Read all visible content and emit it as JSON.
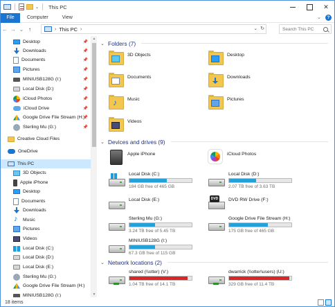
{
  "window": {
    "title": "This PC",
    "minimize_label": "",
    "maximize_label": "",
    "close_label": "✕"
  },
  "ribbon": {
    "tabs": [
      "File",
      "Computer",
      "View"
    ],
    "expand_glyph": "⌄",
    "help_glyph": "?"
  },
  "address": {
    "back_glyph": "←",
    "forward_glyph": "→",
    "recent_glyph": "⌄",
    "up_glyph": "↑",
    "path": "This PC",
    "separator": "›",
    "dropdown_glyph": "⌄",
    "refresh_glyph": "↻",
    "search_placeholder": "Search This PC"
  },
  "nav": {
    "pin_glyph": "📌",
    "items": [
      {
        "label": "Desktop",
        "icon": "desktop-icon",
        "pinned": true
      },
      {
        "label": "Downloads",
        "icon": "downloads-icon",
        "pinned": true
      },
      {
        "label": "Documents",
        "icon": "documents-icon",
        "pinned": true
      },
      {
        "label": "Pictures",
        "icon": "pictures-icon",
        "pinned": true
      },
      {
        "label": "MINIUSB128G (I:)",
        "icon": "usb-drive-icon",
        "pinned": true
      },
      {
        "label": "Local Disk (D:)",
        "icon": "drive-icon",
        "pinned": true
      },
      {
        "label": "iCloud Photos",
        "icon": "icloud-photos-icon",
        "pinned": true
      },
      {
        "label": "iCloud Drive",
        "icon": "icloud-drive-icon",
        "pinned": true
      },
      {
        "label": "Google Drive File Stream (H:)",
        "icon": "google-drive-icon",
        "pinned": true
      },
      {
        "label": "Sterling Mu (G:)",
        "icon": "user-drive-icon",
        "pinned": true
      },
      {
        "label": "Creative Cloud Files",
        "icon": "creative-cloud-icon",
        "pinned": false
      },
      {
        "label": "OneDrive",
        "icon": "onedrive-icon",
        "pinned": false
      },
      {
        "label": "This PC",
        "icon": "this-pc-icon",
        "pinned": false
      },
      {
        "label": "3D Objects",
        "icon": "3d-objects-icon",
        "pinned": false
      },
      {
        "label": "Apple iPhone",
        "icon": "iphone-icon",
        "pinned": false
      },
      {
        "label": "Desktop",
        "icon": "desktop-icon",
        "pinned": false
      },
      {
        "label": "Documents",
        "icon": "documents-icon",
        "pinned": false
      },
      {
        "label": "Downloads",
        "icon": "downloads-icon",
        "pinned": false
      },
      {
        "label": "Music",
        "icon": "music-icon",
        "pinned": false
      },
      {
        "label": "Pictures",
        "icon": "pictures-icon",
        "pinned": false
      },
      {
        "label": "Videos",
        "icon": "videos-icon",
        "pinned": false
      },
      {
        "label": "Local Disk (C:)",
        "icon": "windows-drive-icon",
        "pinned": false
      },
      {
        "label": "Local Disk (D:)",
        "icon": "drive-icon",
        "pinned": false
      },
      {
        "label": "Local Disk (E:)",
        "icon": "drive-icon",
        "pinned": false
      },
      {
        "label": "Sterling Mu (G:)",
        "icon": "user-drive-icon",
        "pinned": false
      },
      {
        "label": "Google Drive File Stream (H:)",
        "icon": "google-drive-icon",
        "pinned": false
      },
      {
        "label": "MINIUSB128G (I:)",
        "icon": "usb-drive-icon",
        "pinned": false
      }
    ]
  },
  "groups": {
    "folders": {
      "header": "Folders (7)",
      "items": [
        {
          "label": "3D Objects",
          "badge": "objects"
        },
        {
          "label": "Desktop",
          "badge": "desktop"
        },
        {
          "label": "Documents",
          "badge": "docs"
        },
        {
          "label": "Downloads",
          "badge": "downloads"
        },
        {
          "label": "Music",
          "badge": "music"
        },
        {
          "label": "Pictures",
          "badge": "pictures"
        },
        {
          "label": "Videos",
          "badge": "videos"
        }
      ]
    },
    "devices": {
      "header": "Devices and drives (9)",
      "items": [
        {
          "label": "Apple iPhone",
          "kind": "phone",
          "sub": "",
          "used_fraction": null
        },
        {
          "label": "iCloud Photos",
          "kind": "photos",
          "sub": "",
          "used_fraction": null
        },
        {
          "label": "Local Disk (C:)",
          "kind": "windows",
          "sub": "184 GB free of 465 GB",
          "used_fraction": 0.6
        },
        {
          "label": "Local Disk (D:)",
          "kind": "drive",
          "sub": "2.07 TB free of 3.63 TB",
          "used_fraction": 0.43
        },
        {
          "label": "Local Disk (E:)",
          "kind": "drive",
          "sub": "",
          "used_fraction": null
        },
        {
          "label": "DVD RW Drive (F:)",
          "kind": "dvd",
          "sub": "",
          "used_fraction": null
        },
        {
          "label": "Sterling Mu (G:)",
          "kind": "drive",
          "sub": "3.24 TB free of 5.45 TB",
          "used_fraction": 0.41
        },
        {
          "label": "Google Drive File Stream (H:)",
          "kind": "drive",
          "sub": "175 GB free of 465 GB",
          "used_fraction": 0.62
        },
        {
          "label": "MINIUSB128G (I:)",
          "kind": "drive",
          "sub": "67.3 GB free of 115 GB",
          "used_fraction": 0.41
        }
      ]
    },
    "network": {
      "header": "Network locations (2)",
      "items": [
        {
          "label": "shared (\\\\otter) (V:)",
          "sub": "1.04 TB free of 14.1 TB",
          "used_fraction": 0.93
        },
        {
          "label": "dwarrick (\\\\otter\\users) (U:)",
          "sub": "329 GB free of 11.4 TB",
          "used_fraction": 0.97
        }
      ]
    }
  },
  "status": {
    "item_count": "18 items"
  },
  "colors": {
    "accent": "#1a74d2",
    "bar_fill": "#26a0da",
    "bar_fill_full": "#da2626",
    "group_header": "#1e3287",
    "selection": "#cce8ff"
  }
}
